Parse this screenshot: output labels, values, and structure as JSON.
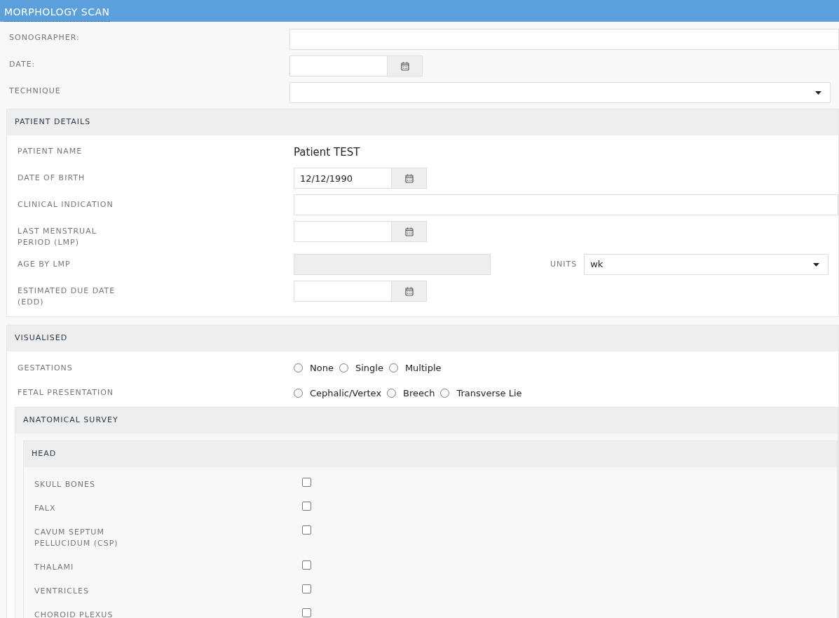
{
  "header": {
    "title": "MORPHOLOGY SCAN"
  },
  "top_fields": [
    {
      "label": "SONOGRAPHER:",
      "kind": "text"
    },
    {
      "label": "DATE:",
      "kind": "date"
    },
    {
      "label": "TECHNIQUE",
      "kind": "select"
    }
  ],
  "patient_details": {
    "title": "PATIENT DETAILS",
    "fields": [
      {
        "label": "PATIENT NAME",
        "kind": "static",
        "value": "Patient TEST"
      },
      {
        "label": "DATE OF BIRTH",
        "kind": "date",
        "value": "12/12/1990"
      },
      {
        "label": "CLINICAL INDICATION",
        "kind": "text"
      },
      {
        "label": "LAST MENSTRUAL PERIOD (LMP)",
        "kind": "date"
      },
      {
        "label": "AGE BY LMP",
        "kind": "readonly",
        "units": {
          "label": "UNITS",
          "value": "wk"
        }
      },
      {
        "label": "ESTIMATED DUE DATE (EDD)",
        "kind": "date"
      }
    ]
  },
  "visualised": {
    "title": "VISUALISED",
    "radio_groups": [
      {
        "label": "GESTATIONS",
        "options": [
          {
            "label": "None",
            "selected": false
          },
          {
            "label": "Single",
            "selected": false
          },
          {
            "label": "Multiple",
            "selected": false
          }
        ]
      },
      {
        "label": "FETAL PRESENTATION",
        "options": [
          {
            "label": "Cephalic/Vertex",
            "selected": false
          },
          {
            "label": "Breech",
            "selected": false
          },
          {
            "label": "Transverse Lie",
            "selected": false
          }
        ]
      }
    ],
    "anatomical_survey": {
      "title": "ANATOMICAL SURVEY",
      "sections": [
        {
          "title": "HEAD",
          "items": [
            {
              "label": "SKULL BONES",
              "checked": false
            },
            {
              "label": "FALX",
              "checked": false
            },
            {
              "label": "CAVUM SEPTUM PELLUCIDUM (CSP)",
              "checked": false
            },
            {
              "label": "THALAMI",
              "checked": false
            },
            {
              "label": "VENTRICLES",
              "checked": false
            },
            {
              "label": "CHOROID PLEXUS",
              "checked": false
            }
          ]
        }
      ]
    }
  }
}
